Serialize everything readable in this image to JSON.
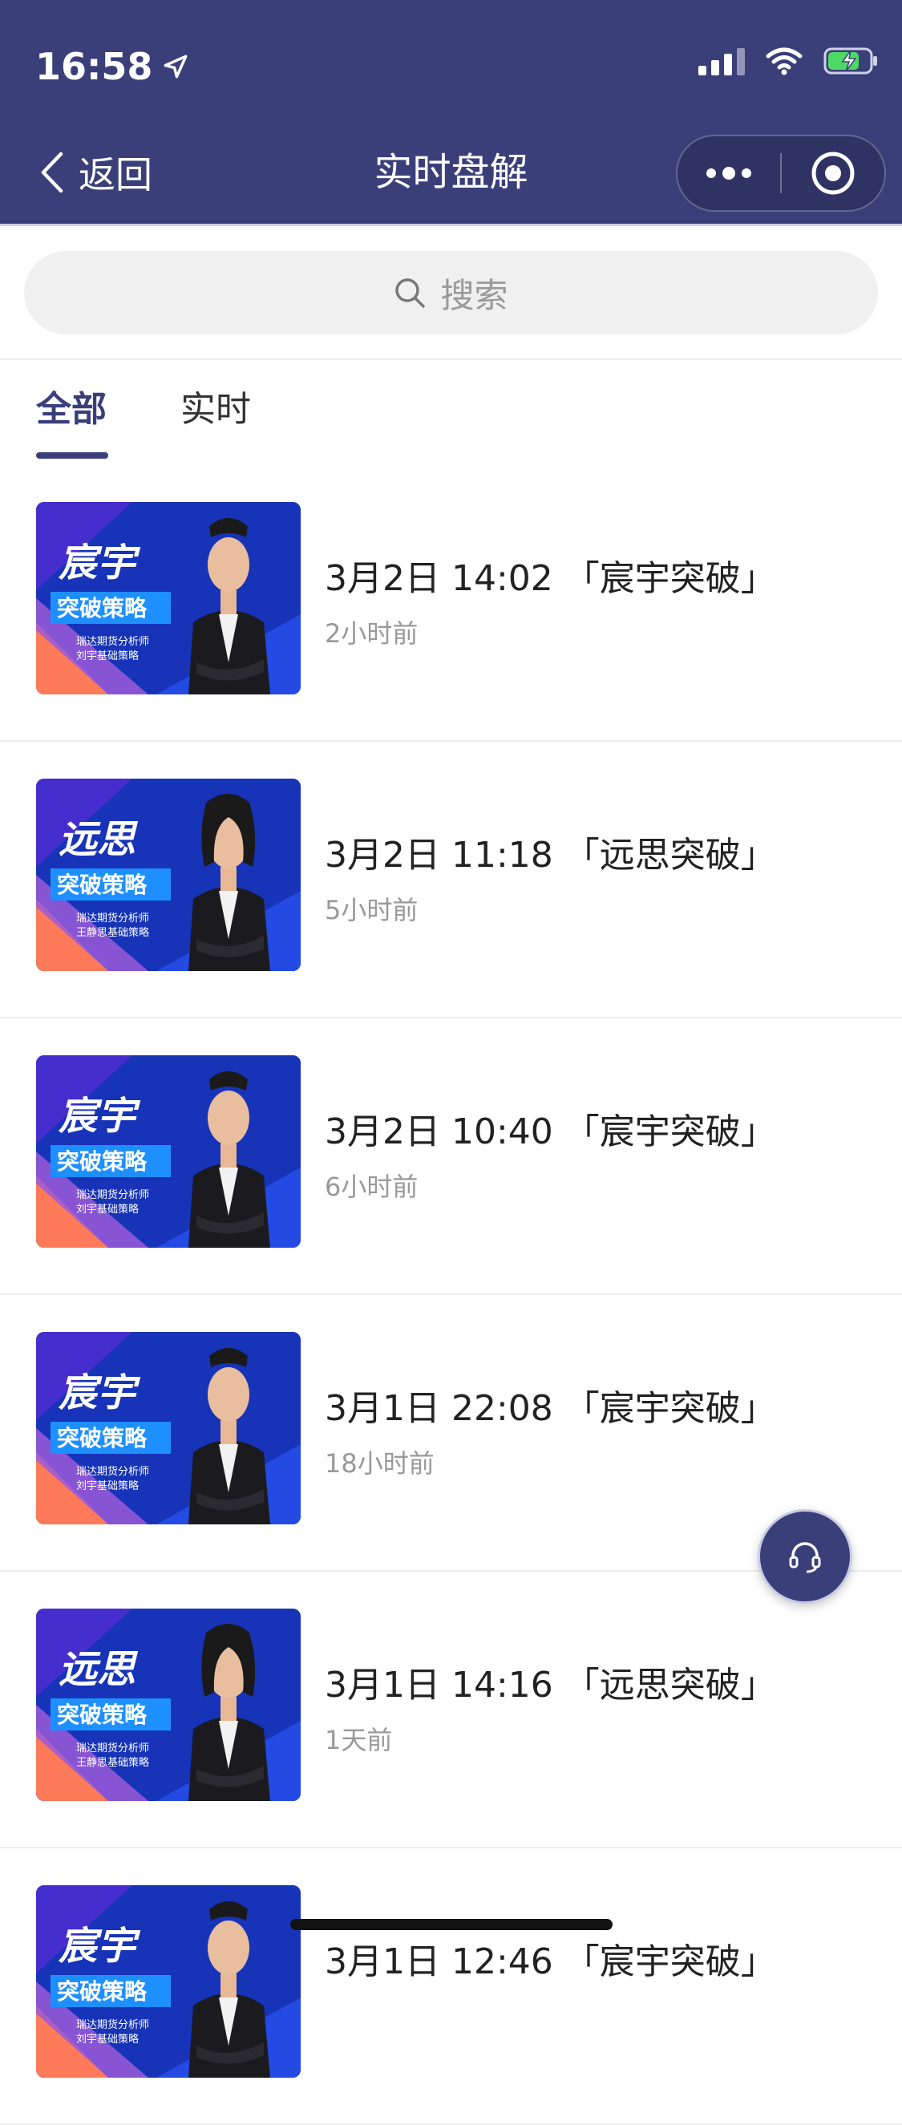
{
  "status_bar": {
    "time": "16:58",
    "icons": [
      "location-arrow-icon",
      "signal-icon",
      "wifi-icon",
      "battery-charging-icon"
    ]
  },
  "nav": {
    "back_label": "返回",
    "title": "实时盘解",
    "capsule_icons": [
      "more-dots-icon",
      "record-target-icon"
    ]
  },
  "search": {
    "placeholder": "搜索"
  },
  "tabs": [
    {
      "label": "全部",
      "active": true
    },
    {
      "label": "实时",
      "active": false
    }
  ],
  "items": [
    {
      "title": "3月2日 14:02 「宸宇突破」",
      "time_ago": "2小时前",
      "thumb": {
        "name": "宸宇",
        "strategy": "突破策略",
        "line1": "瑞达期货分析师",
        "line2": "刘宇基础策略",
        "presenter": "male"
      }
    },
    {
      "title": "3月2日 11:18 「远思突破」",
      "time_ago": "5小时前",
      "thumb": {
        "name": "远思",
        "strategy": "突破策略",
        "line1": "瑞达期货分析师",
        "line2": "王静思基础策略",
        "presenter": "female"
      }
    },
    {
      "title": "3月2日 10:40 「宸宇突破」",
      "time_ago": "6小时前",
      "thumb": {
        "name": "宸宇",
        "strategy": "突破策略",
        "line1": "瑞达期货分析师",
        "line2": "刘宇基础策略",
        "presenter": "male"
      }
    },
    {
      "title": "3月1日 22:08 「宸宇突破」",
      "time_ago": "18小时前",
      "thumb": {
        "name": "宸宇",
        "strategy": "突破策略",
        "line1": "瑞达期货分析师",
        "line2": "刘宇基础策略",
        "presenter": "male"
      }
    },
    {
      "title": "3月1日 14:16 「远思突破」",
      "time_ago": "1天前",
      "thumb": {
        "name": "远思",
        "strategy": "突破策略",
        "line1": "瑞达期货分析师",
        "line2": "王静思基础策略",
        "presenter": "female"
      }
    },
    {
      "title": "3月1日 12:46 「宸宇突破」",
      "time_ago": "",
      "thumb": {
        "name": "宸宇",
        "strategy": "突破策略",
        "line1": "瑞达期货分析师",
        "line2": "刘宇基础策略",
        "presenter": "male"
      }
    }
  ],
  "fab": {
    "icon": "customer-service-headset-icon"
  },
  "colors": {
    "primary": "#3a3f7a",
    "thumb_blue": "#1733b8",
    "thumb_accent": "#1e8fff",
    "thumb_orange": "#ff7a59",
    "muted_text": "#999999"
  }
}
